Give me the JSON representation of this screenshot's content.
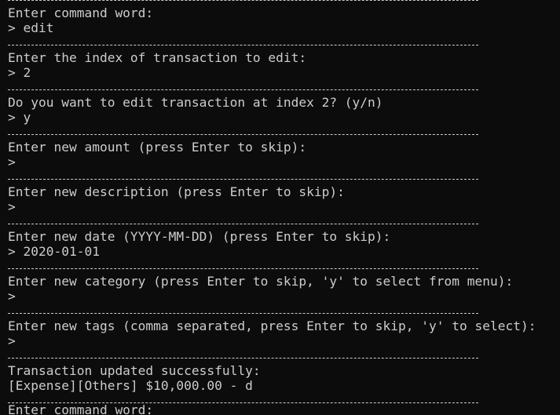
{
  "blocks": [
    {
      "prompt": "Enter command word:",
      "response": "> edit"
    },
    {
      "prompt": "Enter the index of transaction to edit:",
      "response": "> 2"
    },
    {
      "prompt": "Do you want to edit transaction at index 2? (y/n)",
      "response": "> y"
    },
    {
      "prompt": "Enter new amount (press Enter to skip):",
      "response": ">"
    },
    {
      "prompt": "Enter new description (press Enter to skip):",
      "response": ">"
    },
    {
      "prompt": "Enter new date (YYYY-MM-DD) (press Enter to skip):",
      "response": "> 2020-01-01"
    },
    {
      "prompt": "Enter new category (press Enter to skip, 'y' to select from menu):",
      "response": ">"
    },
    {
      "prompt": "Enter new tags (comma separated, press Enter to skip, 'y' to select):",
      "response": ">"
    },
    {
      "prompt": "Transaction updated successfully:",
      "response": "[Expense][Others] $10,000.00 - d"
    }
  ],
  "footer_partial": "Enter command word:"
}
